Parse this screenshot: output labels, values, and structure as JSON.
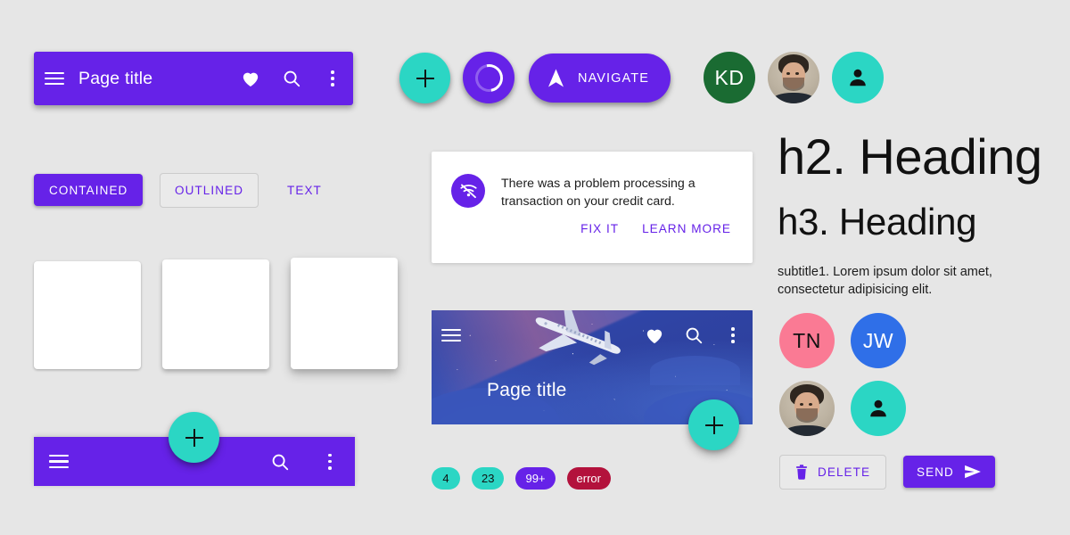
{
  "theme": {
    "background": "#e6e6e6",
    "primary": "#6622e8",
    "secondary": "#2bd6c4",
    "error": "#b3123c",
    "surface": "#ffffff"
  },
  "top_app_bar": {
    "menu_icon": "hamburger-menu-icon",
    "title": "Page title",
    "favorite_icon": "heart-icon",
    "search_icon": "search-icon",
    "overflow_icon": "more-vert-icon"
  },
  "fabs": {
    "add_label": "add-icon",
    "progress_label": "circular-progress-icon",
    "extended": {
      "icon": "navigation-arrow-icon",
      "label": "NAVIGATE"
    }
  },
  "avatars_top": [
    {
      "type": "initials",
      "text": "KD",
      "bg": "#1a6b32",
      "fg": "#ffffff"
    },
    {
      "type": "photo",
      "text": "",
      "bg": "",
      "fg": ""
    },
    {
      "type": "icon",
      "text": "person-icon",
      "bg": "#2bd6c4",
      "fg": "#111111"
    }
  ],
  "buttons": {
    "contained": "CONTAINED",
    "outlined": "OUTLINED",
    "text": "TEXT"
  },
  "cards": [
    {
      "elevation": "1"
    },
    {
      "elevation": "4"
    },
    {
      "elevation": "8"
    }
  ],
  "bottom_app_bar": {
    "menu_icon": "hamburger-menu-icon",
    "search_icon": "search-icon",
    "overflow_icon": "more-vert-icon",
    "fab_icon": "add-icon"
  },
  "banner": {
    "icon": "wifi-off-icon",
    "message": "There was a problem processing a transaction on your credit card.",
    "actions": [
      {
        "label": "FIX IT"
      },
      {
        "label": "LEARN MORE"
      }
    ]
  },
  "hero": {
    "menu_icon": "hamburger-menu-icon",
    "favorite_icon": "heart-icon",
    "search_icon": "search-icon",
    "overflow_icon": "more-vert-icon",
    "title": "Page title",
    "fab_icon": "add-icon",
    "image": "airplane-night-sky-illustration"
  },
  "badges": [
    {
      "label": "4",
      "style": "teal"
    },
    {
      "label": "23",
      "style": "teal"
    },
    {
      "label": "99+",
      "style": "purple"
    },
    {
      "label": "error",
      "style": "error"
    }
  ],
  "typography": {
    "h2": "h2. Heading",
    "h3": "h3. Heading",
    "subtitle": "subtitle1. Lorem ipsum dolor sit amet, consectetur adipisicing elit."
  },
  "avatars_grid": [
    {
      "type": "initials",
      "text": "TN",
      "bg": "#fa7a94",
      "fg": "#111111"
    },
    {
      "type": "initials",
      "text": "JW",
      "bg": "#2f6fe8",
      "fg": "#ffffff"
    },
    {
      "type": "photo",
      "text": "",
      "bg": "",
      "fg": ""
    },
    {
      "type": "icon",
      "text": "person-icon",
      "bg": "#2bd6c4",
      "fg": "#111111"
    }
  ],
  "actions": {
    "delete": {
      "label": "DELETE",
      "icon": "trash-icon"
    },
    "send": {
      "label": "SEND",
      "icon": "send-icon"
    }
  }
}
